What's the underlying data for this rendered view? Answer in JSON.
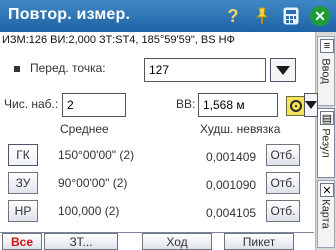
{
  "title": "Повтор. измер.",
  "titlebar_icons": [
    "question-icon",
    "pin-icon",
    "calculator-icon",
    "close-icon"
  ],
  "info_line": "ИЗМ:126  ВИ:2,000  ЗТ:ST4, 185°59'59\", BS НФ",
  "form": {
    "front_point_label": "Перед. точка:",
    "front_point_value": "127",
    "count_label": "Чис. наб.:",
    "count_value": "2",
    "height_label": "ВВ:",
    "height_value": "1,568 м"
  },
  "table": {
    "headers": [
      "Среднее",
      "Худш. невязка"
    ],
    "rows": [
      {
        "button": "ГК",
        "mean": "150°00'00\" (2)",
        "worst": "0,001409",
        "action": "Отб."
      },
      {
        "button": "ЗУ",
        "mean": "90°00'00\" (2)",
        "worst": "0,001090",
        "action": "Отб."
      },
      {
        "button": "НР",
        "mean": "100,000 (2)",
        "worst": "0,004105",
        "action": "Отб."
      }
    ]
  },
  "footer_buttons": [
    "Все",
    "ЗТ...",
    "Ход",
    "Пикет"
  ],
  "side_tabs": [
    "Ввод",
    "Резул",
    "Карта"
  ],
  "colors": {
    "titlebar": "#2a6fb2",
    "red_button_text": "#d41313",
    "close_icon": "#1d9b37"
  }
}
